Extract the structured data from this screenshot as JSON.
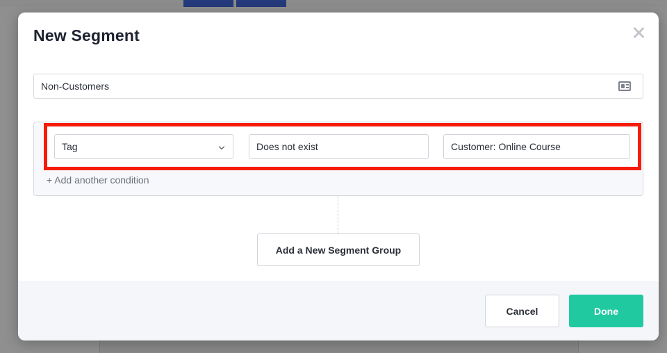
{
  "modal": {
    "title": "New Segment"
  },
  "segment": {
    "name_value": "Non-Customers"
  },
  "condition": {
    "field": "Tag",
    "operator": "Does not exist",
    "value": "Customer: Online Course"
  },
  "actions": {
    "add_condition": "+ Add another condition",
    "add_group": "Add a New Segment Group",
    "cancel": "Cancel",
    "done": "Done"
  },
  "icons": {
    "close": "close-icon",
    "name_field": "id-card-icon",
    "dropdown": "chevron-down-icon"
  },
  "colors": {
    "primary": "#21c9a1",
    "highlight": "#f51c0c",
    "title": "#1d2230"
  }
}
